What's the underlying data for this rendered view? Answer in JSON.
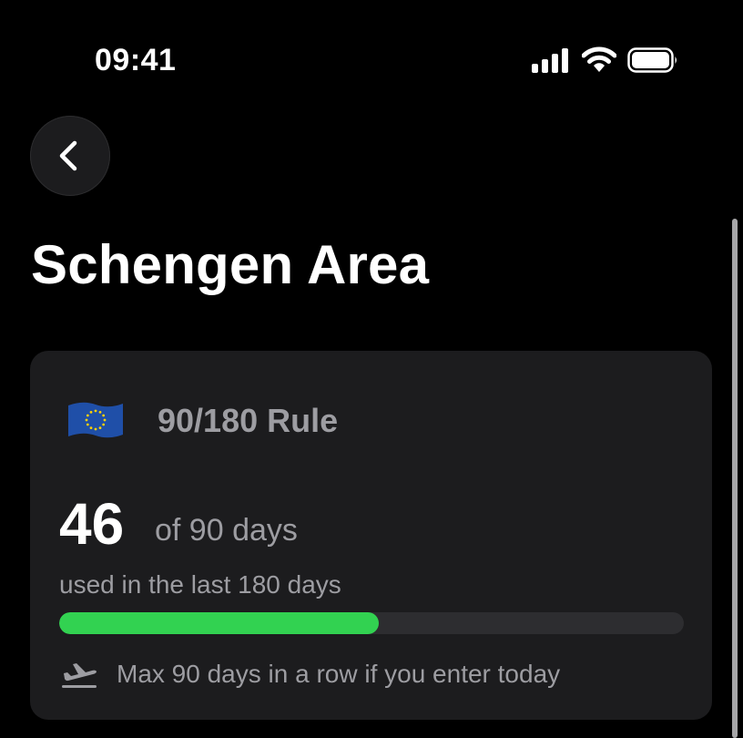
{
  "status_bar": {
    "time": "09:41",
    "icons": [
      "signal-icon",
      "wifi-icon",
      "battery-icon"
    ]
  },
  "nav": {
    "back_icon": "chevron-left-icon"
  },
  "page": {
    "title": "Schengen Area"
  },
  "rule_card": {
    "flag_icon": "eu-flag-icon",
    "title": "90/180 Rule",
    "days_used": "46",
    "days_total_text": "of 90 days",
    "caption": "used in the last 180 days",
    "progress_fraction": 0.511,
    "max_stay_icon": "airplane-departure-icon",
    "max_stay_text": "Max 90 days in a row if you enter today"
  },
  "colors": {
    "background": "#000000",
    "card": "#1c1c1e",
    "secondary_text": "#9d9da2",
    "progress_fill": "#32d251",
    "progress_track": "#2d2d30",
    "eu_blue": "#1f4fa8",
    "eu_star": "#ffd200"
  }
}
